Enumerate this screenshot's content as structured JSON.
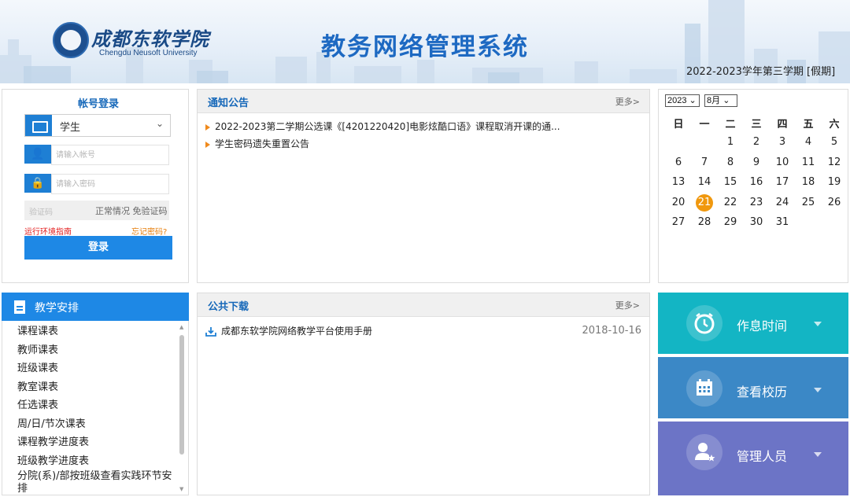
{
  "header": {
    "school_cn": "成都东软学院",
    "school_en": "Chengdu Neusoft University",
    "system_title": "教务网络管理系统",
    "term": "2022-2023学年第三学期 [假期]"
  },
  "login": {
    "title": "帐号登录",
    "role": "学生",
    "account_placeholder": "请输入帐号",
    "password_placeholder": "请输入密码",
    "captcha_placeholder": "验证码",
    "captcha_status": "正常情况 免验证码",
    "env_guide": "运行环境指南",
    "forgot": "忘记密码?",
    "submit": "登录"
  },
  "notice": {
    "title": "通知公告",
    "more": "更多>",
    "items": [
      "2022-2023第二学期公选课《[4201220420]电影炫酷口语》课程取消开课的通...",
      "学生密码遗失重置公告"
    ]
  },
  "calendar": {
    "year": "2023",
    "month": "8月",
    "weekdays": [
      "日",
      "一",
      "二",
      "三",
      "四",
      "五",
      "六"
    ],
    "today": "21",
    "weeks": [
      [
        "",
        "",
        "1",
        "2",
        "3",
        "4",
        "5"
      ],
      [
        "6",
        "7",
        "8",
        "9",
        "10",
        "11",
        "12"
      ],
      [
        "13",
        "14",
        "15",
        "16",
        "17",
        "18",
        "19"
      ],
      [
        "20",
        "21",
        "22",
        "23",
        "24",
        "25",
        "26"
      ],
      [
        "27",
        "28",
        "29",
        "30",
        "31",
        "",
        ""
      ]
    ]
  },
  "teaching": {
    "title": "教学安排",
    "items": [
      "课程课表",
      "教师课表",
      "班级课表",
      "教室课表",
      "任选课表",
      "周/日/节次课表",
      "课程教学进度表",
      "班级教学进度表",
      "分院(系)/部按班级查看实践环节安排"
    ]
  },
  "downloads": {
    "title": "公共下载",
    "more": "更多>",
    "items": [
      {
        "name": "成都东软学院网络教学平台使用手册",
        "date": "2018-10-16"
      }
    ]
  },
  "tiles": [
    {
      "label": "作息时间",
      "icon": "alarm-clock-icon",
      "color": "#13b5c4"
    },
    {
      "label": "查看校历",
      "icon": "calendar-icon",
      "color": "#3b88c6"
    },
    {
      "label": "管理人员",
      "icon": "admin-user-icon",
      "color": "#6c74c6"
    }
  ]
}
